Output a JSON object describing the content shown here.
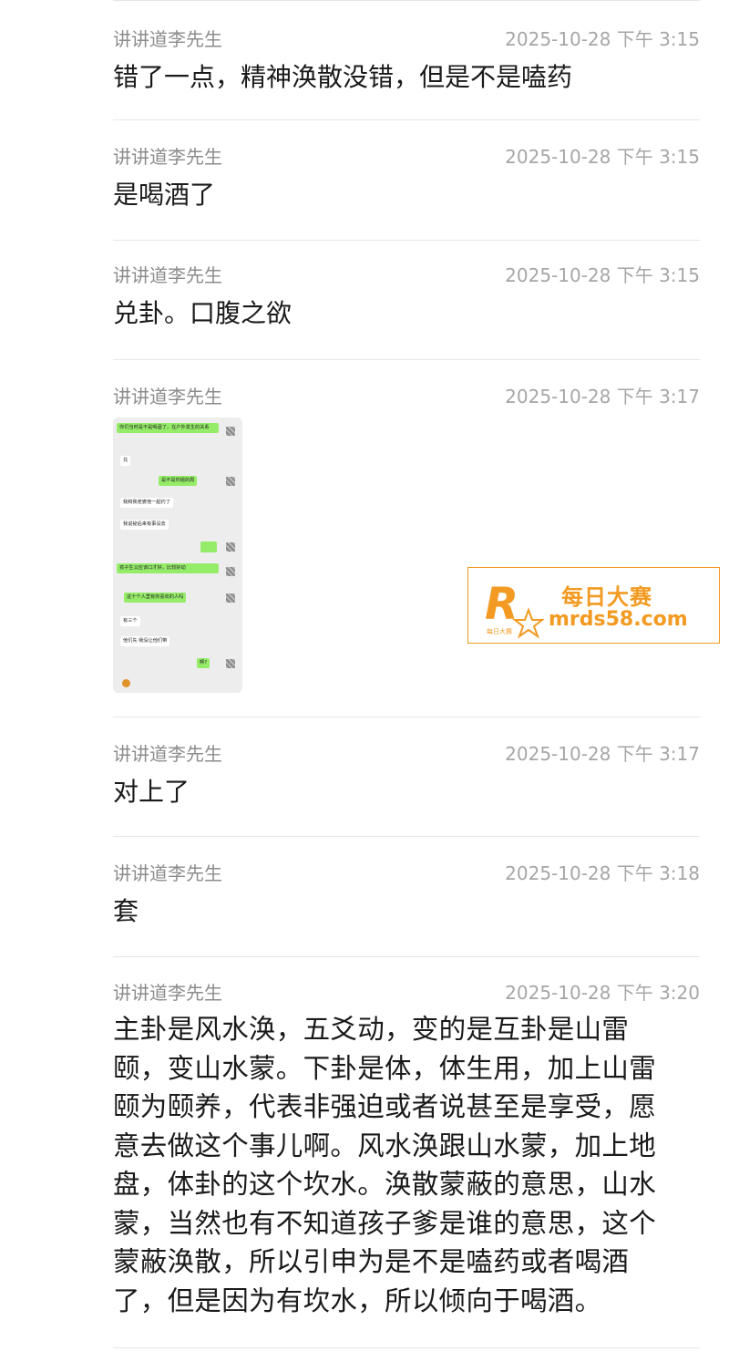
{
  "messages": [
    {
      "sender": "讲讲道李先生",
      "time": "2025-10-28 下午 3:15",
      "text": "错了一点，精神涣散没错，但是不是嗑药"
    },
    {
      "sender": "讲讲道李先生",
      "time": "2025-10-28 下午 3:15",
      "text": "是喝酒了"
    },
    {
      "sender": "讲讲道李先生",
      "time": "2025-10-28 下午 3:15",
      "text": "兑卦。口腹之欲"
    },
    {
      "sender": "讲讲道李先生",
      "time": "2025-10-28 下午 3:17",
      "image": {
        "bubbles": [
          "你们当时是不是喝酒了，在户外发生的关系",
          "兑",
          "是不是你姐的局",
          "我和我老婆他一起约了",
          "我说祕后来有事没去",
          "",
          "孩子生父应该口才好，比较好动",
          "这十个人里有你喜欢的人吗",
          "有三个",
          "他们先 我没让他们带",
          "啊?"
        ]
      }
    },
    {
      "sender": "讲讲道李先生",
      "time": "2025-10-28 下午 3:17",
      "text": "对上了"
    },
    {
      "sender": "讲讲道李先生",
      "time": "2025-10-28 下午 3:18",
      "text": "套"
    },
    {
      "sender": "讲讲道李先生",
      "time": "2025-10-28 下午 3:20",
      "lines": [
        "主卦是风水涣，五爻动，变的是互卦是山雷",
        "颐，变山水蒙。下卦是体，体生用，加上山雷",
        "颐为颐养，代表非强迫或者说甚至是享受，愿",
        "意去做这个事儿啊。风水涣跟山水蒙，加上地",
        "盘，体卦的这个坎水。涣散蒙蔽的意思，山水",
        "蒙，当然也有不知道孩子爹是谁的意思，这个",
        "蒙蔽涣散，所以引申为是不是嗑药或者喝酒",
        "了，但是因为有坎水，所以倾向于喝酒。"
      ]
    }
  ],
  "watermark": {
    "cn": "每日大赛",
    "url": "mrds58.com",
    "logo_letter": "R",
    "logo_small": "每日大赛",
    "color": "#f29a21"
  }
}
